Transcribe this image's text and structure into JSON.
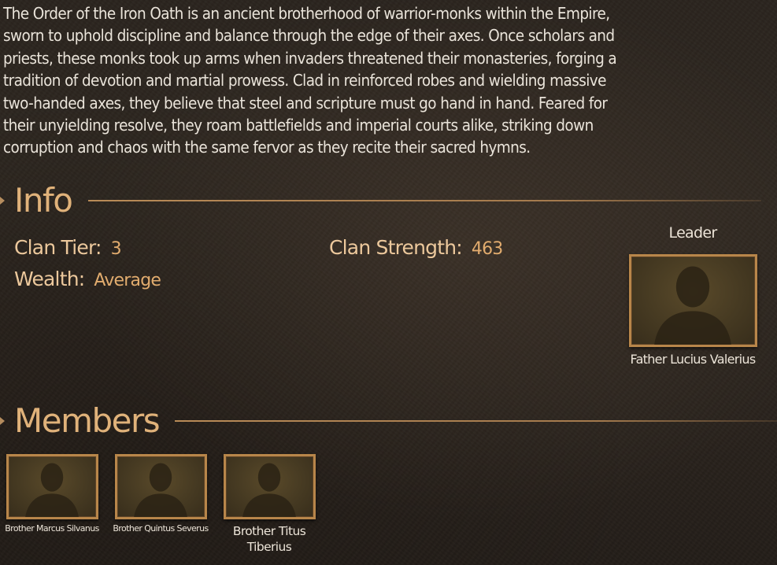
{
  "description": "The Order of the Iron Oath is an ancient brotherhood of warrior-monks within the Empire,\nsworn to uphold discipline and balance through the edge of their axes. Once scholars and\npriests, these monks took up arms when invaders threatened    their monasteries, forging a\ntradition of devotion and martial prowess. Clad in reinforced robes and wielding massive\ntwo-handed axes, they believe that    steel and scripture must go hand in hand. Feared for\ntheir unyielding resolve, they roam battlefields and imperial courts alike, striking down\ncorruption    and chaos with the same fervor as they recite their sacred hymns.",
  "info": {
    "title": "Info",
    "clan_tier_label": "Clan Tier:",
    "clan_tier_value": "3",
    "wealth_label": "Wealth:",
    "wealth_value": "Average",
    "clan_strength_label": "Clan Strength:",
    "clan_strength_value": "463"
  },
  "leader": {
    "caption": "Leader",
    "name": "Father Lucius Valerius",
    "portrait_icon": "person-silhouette-icon"
  },
  "members": {
    "title": "Members",
    "list": [
      {
        "name": "Brother Marcus Silvanus",
        "portrait_icon": "person-silhouette-icon"
      },
      {
        "name": "Brother Quintus Severus",
        "portrait_icon": "person-silhouette-icon"
      },
      {
        "name": "Brother Titus Tiberius",
        "portrait_icon": "person-silhouette-icon"
      }
    ]
  },
  "colors": {
    "accent_gold": "#e0b27a",
    "value_gold": "#e2ac6e",
    "frame_gold": "#b8864a",
    "background": "#2b241e"
  }
}
